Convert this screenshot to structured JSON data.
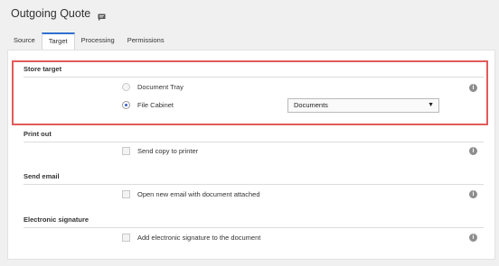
{
  "header": {
    "title": "Outgoing Quote",
    "icon": "comment-icon"
  },
  "tabs": [
    {
      "label": "Source",
      "active": false
    },
    {
      "label": "Target",
      "active": true
    },
    {
      "label": "Processing",
      "active": false
    },
    {
      "label": "Permissions",
      "active": false
    }
  ],
  "sections": {
    "store_target": {
      "title": "Store target",
      "options": [
        {
          "label": "Document Tray",
          "selected": false
        },
        {
          "label": "File Cabinet",
          "selected": true
        }
      ],
      "file_cabinet_select": {
        "value": "Documents"
      }
    },
    "print_out": {
      "title": "Print out",
      "checkbox_label": "Send copy to printer"
    },
    "send_email": {
      "title": "Send email",
      "checkbox_label": "Open new email with document attached"
    },
    "electronic_signature": {
      "title": "Electronic signature",
      "checkbox_label": "Add electronic signature to the document"
    }
  },
  "colors": {
    "accent": "#2f6fcf",
    "highlight": "#e35a5a",
    "info": "#8e8e8e"
  }
}
